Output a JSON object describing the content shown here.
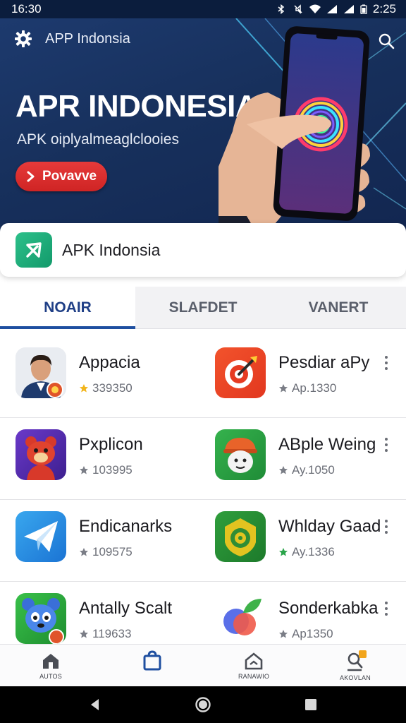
{
  "status_bar": {
    "time_left": "16:30",
    "time_right": "2:25"
  },
  "hero": {
    "app_name": "APP Indonsia",
    "title": "APR INDONESIA",
    "subtitle": "APK oiplyalmeaglclooies",
    "cta_label": "Povavve"
  },
  "brand_card": {
    "name": "APK Indonsia"
  },
  "tabs": [
    {
      "label": "NOAIR",
      "active": true
    },
    {
      "label": "SLAFDET",
      "active": false
    },
    {
      "label": "VANERT",
      "active": false
    }
  ],
  "apps": [
    {
      "name": "Appacia",
      "meta": "339350"
    },
    {
      "name": "Pesdiar aPy",
      "meta": "Ap.1330"
    },
    {
      "name": "Pxplicon",
      "meta": "103995"
    },
    {
      "name": "ABple Weing",
      "meta": "Ay.1050"
    },
    {
      "name": "Endicanarks",
      "meta": "109575"
    },
    {
      "name": "Whlday Gaad",
      "meta": "Ay.1336"
    },
    {
      "name": "Antally Scalt",
      "meta": "119633"
    },
    {
      "name": "Sonderkabka",
      "meta": "Ap1350"
    }
  ],
  "bottom_nav": [
    {
      "label": "AUTOS",
      "icon": "home-icon"
    },
    {
      "label": "",
      "icon": "bag-icon",
      "active": true
    },
    {
      "label": "RANAWIO",
      "icon": "house-icon"
    },
    {
      "label": "AKOVLAN",
      "icon": "profile-icon"
    }
  ],
  "colors": {
    "accent": "#1f4fa0",
    "cta": "#d92c2c",
    "hero_bg": "#17305c"
  }
}
